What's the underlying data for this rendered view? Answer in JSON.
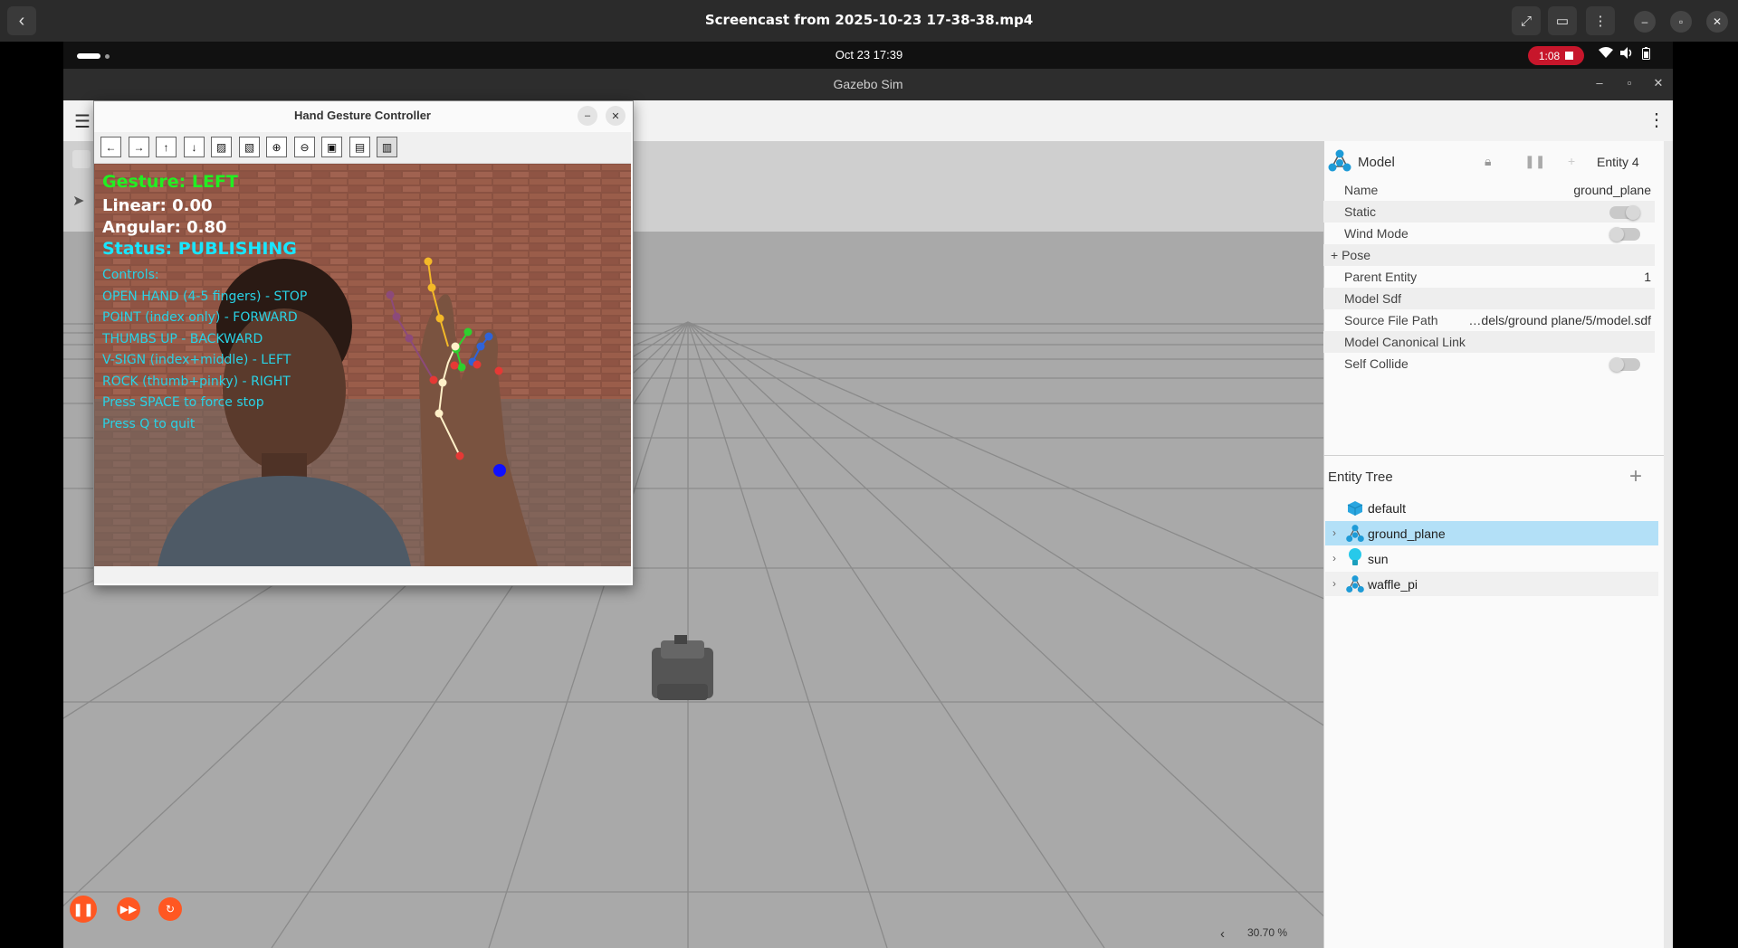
{
  "player": {
    "title": "Screencast from 2025-10-23 17-38-38.mp4"
  },
  "topbar": {
    "clock": "Oct 23  17:39",
    "recording_time": "1:08"
  },
  "gazebo": {
    "window_title": "Gazebo Sim",
    "zoom": "30.70 %",
    "component_inspector": {
      "title": "Model",
      "entity": "Entity 4",
      "rows": [
        {
          "label": "Name",
          "value": "ground_plane"
        },
        {
          "label": "Static",
          "value": ""
        },
        {
          "label": "Wind Mode",
          "value": ""
        },
        {
          "label": "+ Pose",
          "value": ""
        },
        {
          "label": "Parent Entity",
          "value": "1"
        },
        {
          "label": "Model Sdf",
          "value": ""
        },
        {
          "label": "Source File Path",
          "value": "…dels/ground plane/5/model.sdf"
        },
        {
          "label": "Model Canonical Link",
          "value": ""
        },
        {
          "label": "Self Collide",
          "value": ""
        }
      ]
    },
    "entity_tree": {
      "title": "Entity Tree",
      "items": [
        {
          "label": "default",
          "icon": "cube-icon"
        },
        {
          "label": "ground_plane",
          "icon": "model-icon",
          "selected": true
        },
        {
          "label": "sun",
          "icon": "light-bulb-icon"
        },
        {
          "label": "waffle_pi",
          "icon": "model-icon"
        }
      ]
    }
  },
  "hgc": {
    "title": "Hand Gesture Controller",
    "gesture": "Gesture: LEFT",
    "linear": "Linear: 0.00",
    "angular": "Angular: 0.80",
    "status": "Status: PUBLISHING",
    "controls_title": "Controls:",
    "controls": [
      "OPEN HAND (4-5 fingers) - STOP",
      "POINT (index only) - FORWARD",
      "THUMBS UP - BACKWARD",
      "V-SIGN (index+middle) - LEFT",
      "ROCK (thumb+pinky) - RIGHT",
      "Press SPACE to force stop",
      "Press Q to quit"
    ],
    "toolbar_icons": [
      "arrow-left-icon",
      "arrow-right-icon",
      "arrow-up-icon",
      "arrow-down-icon",
      "image-icon",
      "image-edit-icon",
      "zoom-in-icon",
      "zoom-out-icon",
      "save-icon",
      "copy-icon",
      "properties-icon"
    ]
  },
  "colors": {
    "gesture_green": "#22ee22",
    "status_cyan": "#19e6ff",
    "accent_orange": "#ff5722",
    "selection_blue": "#b3e0f7"
  }
}
